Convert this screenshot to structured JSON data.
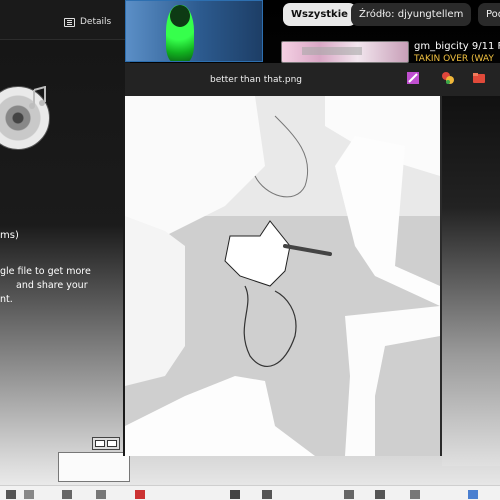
{
  "left_panel": {
    "details_label": "Details",
    "text_line_1": "ms)",
    "text_line_2": "gle file to get more",
    "text_line_3": "and share your",
    "text_line_4": "nt."
  },
  "filter_chips": {
    "all_label": "Wszystkie",
    "source_label": "Źródło: djyungtellem",
    "more_label": "Pod"
  },
  "video": {
    "title": "gm_bigcity 9/11 F",
    "subtitle": "TAKIN OVER (WAY"
  },
  "viewer": {
    "filename": "better than that.png",
    "icons": [
      "edit-icon",
      "share-icon",
      "folder-icon"
    ]
  },
  "colors": {
    "chip_active_bg": "#e9e9e9",
    "accent_green": "#36ff4c",
    "viewer_bar": "#232323"
  }
}
